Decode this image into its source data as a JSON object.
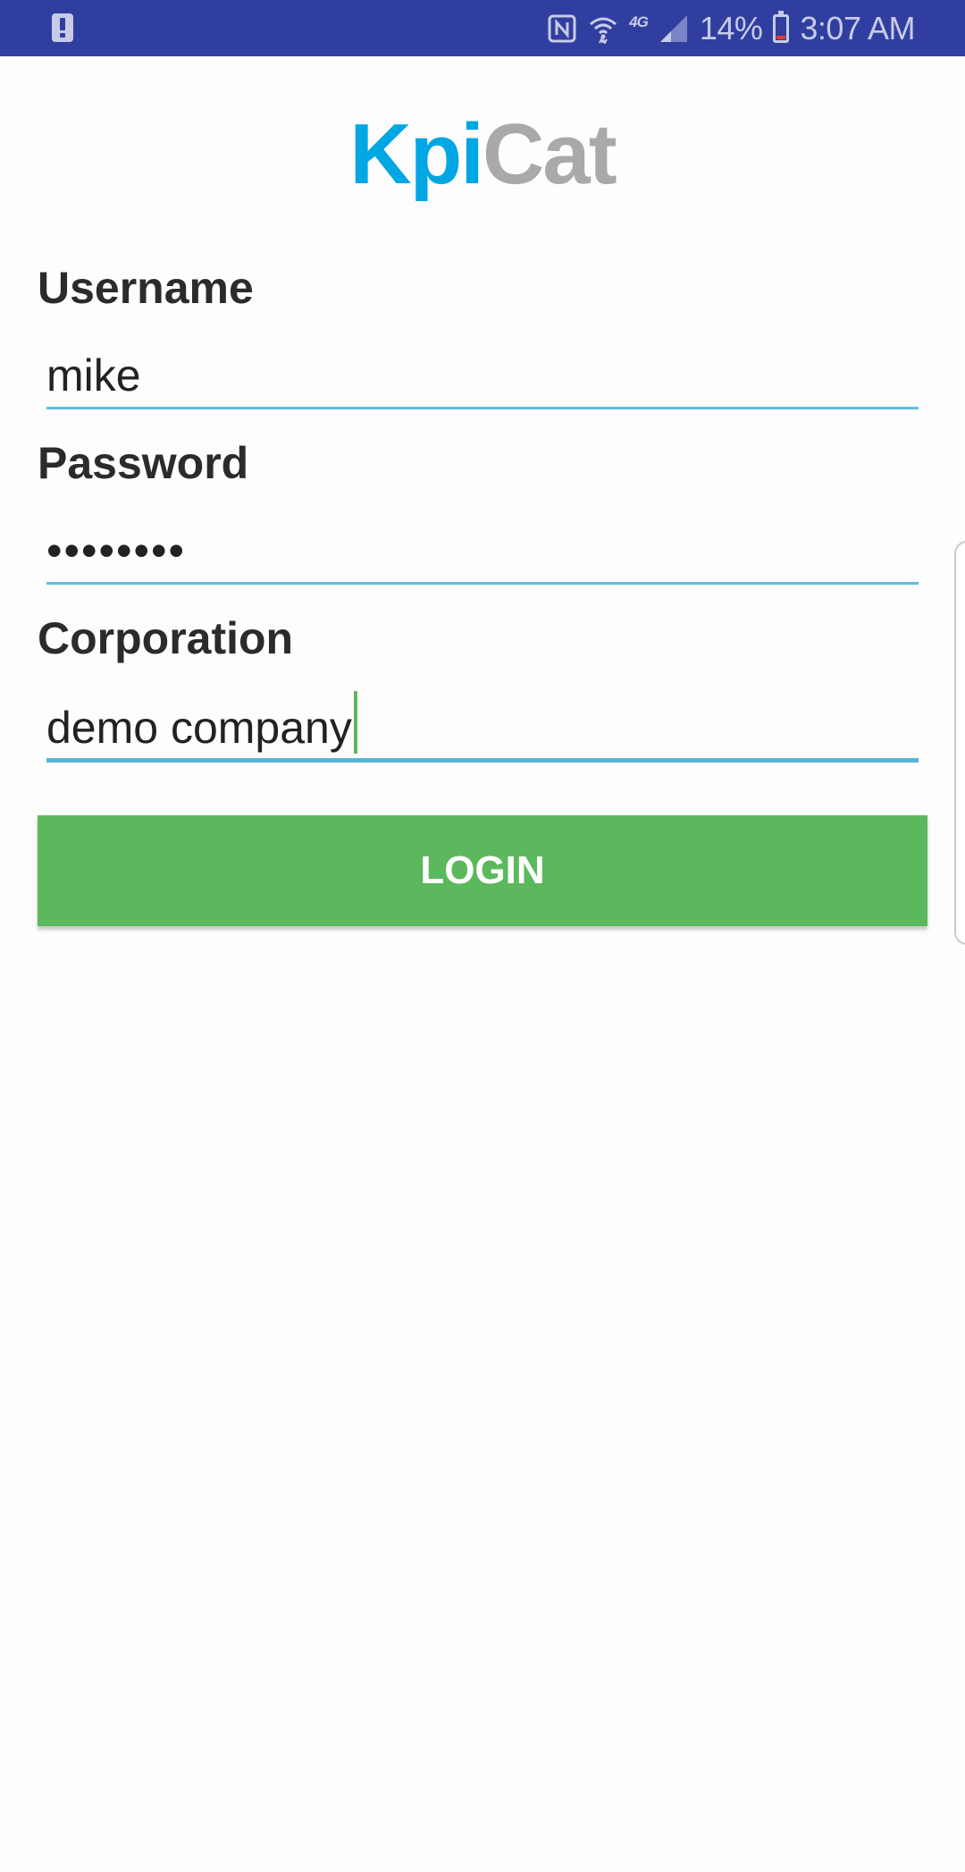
{
  "status_bar": {
    "icons": [
      "alert-icon",
      "nfc-icon",
      "wifi-icon",
      "network-4g-icon",
      "signal-icon",
      "battery-icon"
    ],
    "network_label": "4G",
    "battery_percent": "14%",
    "battery_level": 0.14,
    "time": "3:07 AM"
  },
  "logo": {
    "part1": "Kpi",
    "part2": "Cat",
    "colors": {
      "kpi": "#00a7e3",
      "cat": "#a9a9a9"
    }
  },
  "form": {
    "username": {
      "label": "Username",
      "value": "mike"
    },
    "password": {
      "label": "Password",
      "value": "••••••••"
    },
    "corporation": {
      "label": "Corporation",
      "value": "demo company"
    }
  },
  "login_button": {
    "label": "LOGIN",
    "color": "#5cb85c"
  },
  "colors": {
    "status_bar": "#303f9f",
    "underline": "#5bc0de",
    "caret": "#5cb85c"
  }
}
